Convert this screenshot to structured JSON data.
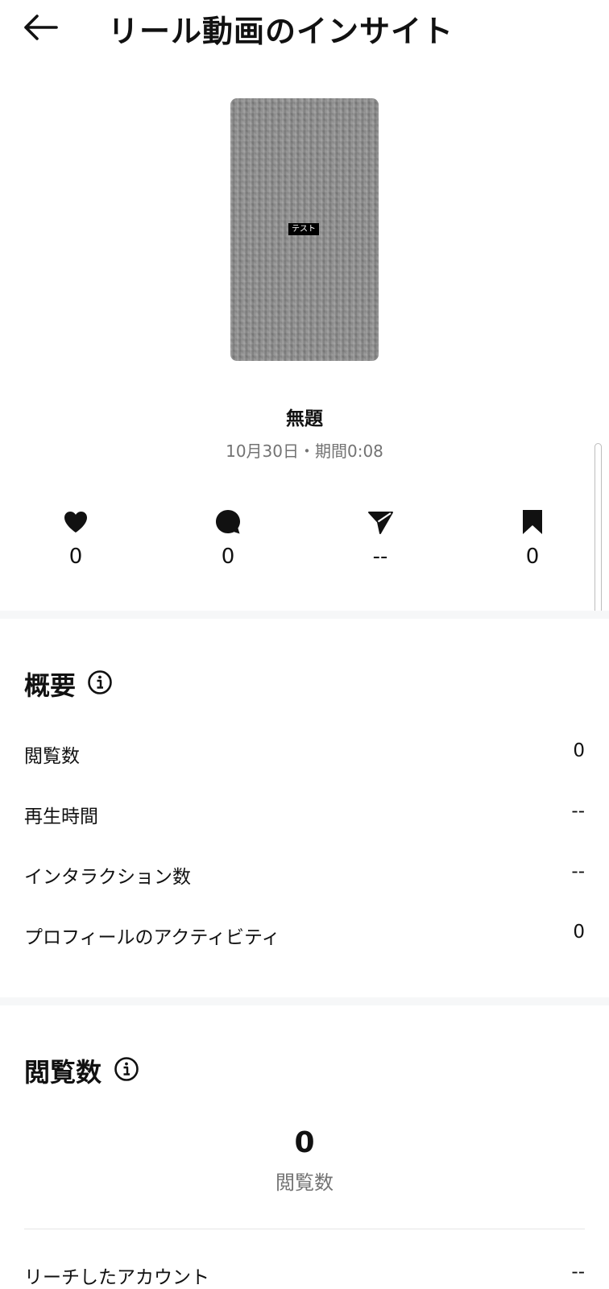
{
  "header": {
    "title": "リール動画のインサイト",
    "back_icon": "arrow-left-icon"
  },
  "thumbnail": {
    "overlay_text": "テスト"
  },
  "post": {
    "title": "無題",
    "meta": "10月30日・期間0:08"
  },
  "stats": [
    {
      "icon": "heart-icon",
      "value": "0"
    },
    {
      "icon": "comment-icon",
      "value": "0"
    },
    {
      "icon": "share-icon",
      "value": "--"
    },
    {
      "icon": "bookmark-icon",
      "value": "0"
    }
  ],
  "overview": {
    "title": "概要",
    "rows": [
      {
        "label": "閲覧数",
        "value": "0"
      },
      {
        "label": "再生時間",
        "value": "--"
      },
      {
        "label": "インタラクション数",
        "value": "--"
      },
      {
        "label": "プロフィールのアクティビティ",
        "value": "0"
      }
    ]
  },
  "views": {
    "title": "閲覧数",
    "total": "0",
    "total_label": "閲覧数",
    "rows": [
      {
        "label": "リーチしたアカウント",
        "value": "--"
      }
    ]
  }
}
